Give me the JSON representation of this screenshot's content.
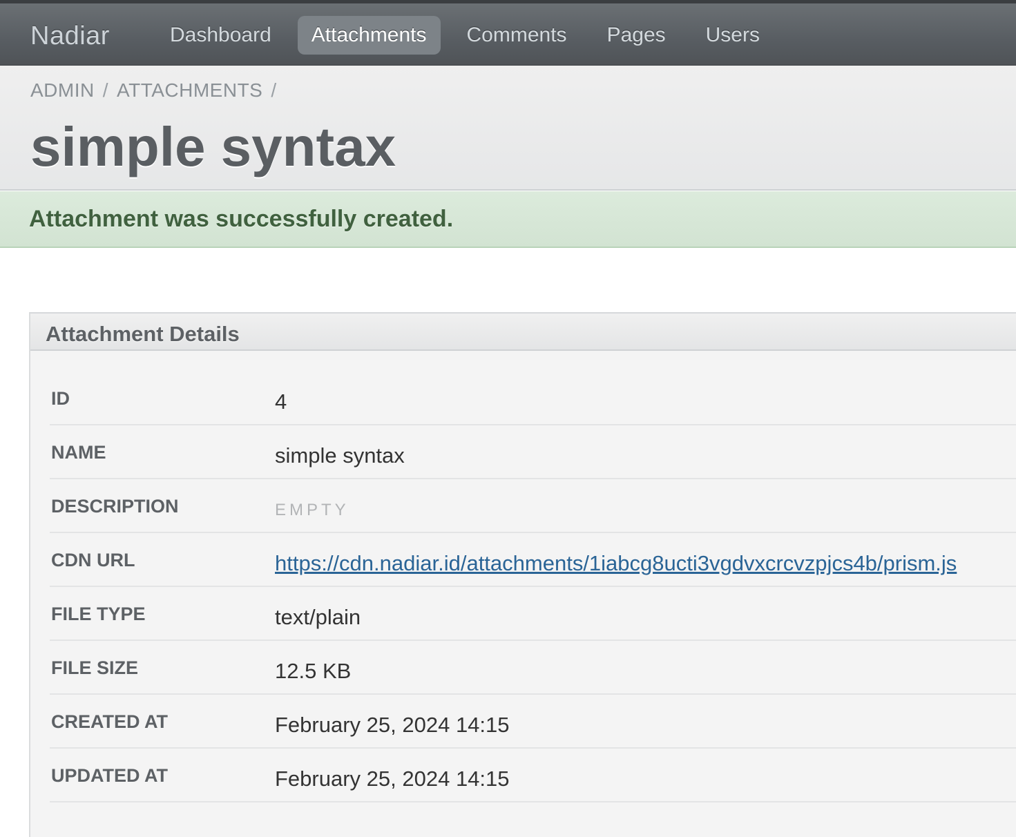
{
  "header": {
    "site_title": "Nadiar",
    "nav": [
      {
        "label": "Dashboard",
        "active": false
      },
      {
        "label": "Attachments",
        "active": true
      },
      {
        "label": "Comments",
        "active": false
      },
      {
        "label": "Pages",
        "active": false
      },
      {
        "label": "Users",
        "active": false
      }
    ]
  },
  "breadcrumb": {
    "items": [
      "ADMIN",
      "ATTACHMENTS"
    ],
    "separator": "/"
  },
  "page_title": "simple syntax",
  "flash": {
    "message": "Attachment was successfully created.",
    "type": "notice"
  },
  "panel": {
    "title": "Attachment Details",
    "rows": [
      {
        "label": "ID",
        "value": "4"
      },
      {
        "label": "NAME",
        "value": "simple syntax"
      },
      {
        "label": "DESCRIPTION",
        "value": "EMPTY",
        "empty": true
      },
      {
        "label": "CDN URL",
        "value": "https://cdn.nadiar.id/attachments/1iabcg8ucti3vgdvxcrcvzpjcs4b/prism.js",
        "link": true
      },
      {
        "label": "FILE TYPE",
        "value": "text/plain"
      },
      {
        "label": "FILE SIZE",
        "value": "12.5 KB"
      },
      {
        "label": "CREATED AT",
        "value": "February 25, 2024 14:15"
      },
      {
        "label": "UPDATED AT",
        "value": "February 25, 2024 14:15"
      }
    ]
  },
  "colors": {
    "header_bg": "#585d62",
    "nav_active_bg": "#7d8388",
    "flash_bg": "#d2e3d2",
    "flash_text": "#40613f",
    "link": "#2a6496"
  }
}
